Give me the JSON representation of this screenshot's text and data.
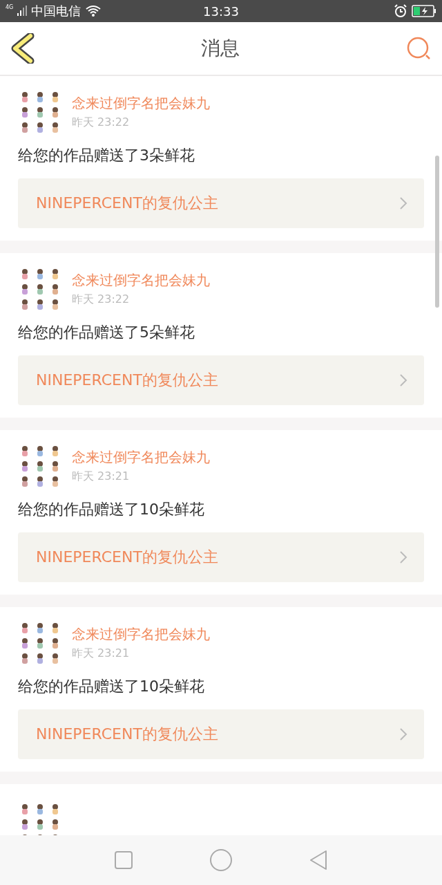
{
  "status_bar": {
    "network": "4G",
    "carrier": "中国电信",
    "time": "13:33"
  },
  "header": {
    "title": "消息"
  },
  "messages": [
    {
      "name": "念来过倒字名把会妹九",
      "time": "昨天 23:22",
      "text": "给您的作品赠送了3朵鲜花",
      "work": "NINEPERCENT的复仇公主"
    },
    {
      "name": "念来过倒字名把会妹九",
      "time": "昨天 23:22",
      "text": "给您的作品赠送了5朵鲜花",
      "work": "NINEPERCENT的复仇公主"
    },
    {
      "name": "念来过倒字名把会妹九",
      "time": "昨天 23:21",
      "text": "给您的作品赠送了10朵鲜花",
      "work": "NINEPERCENT的复仇公主"
    },
    {
      "name": "念来过倒字名把会妹九",
      "time": "昨天 23:21",
      "text": "给您的作品赠送了10朵鲜花",
      "work": "NINEPERCENT的复仇公主"
    },
    {
      "avatar": {
        "kind": "picture"
      }
    }
  ]
}
